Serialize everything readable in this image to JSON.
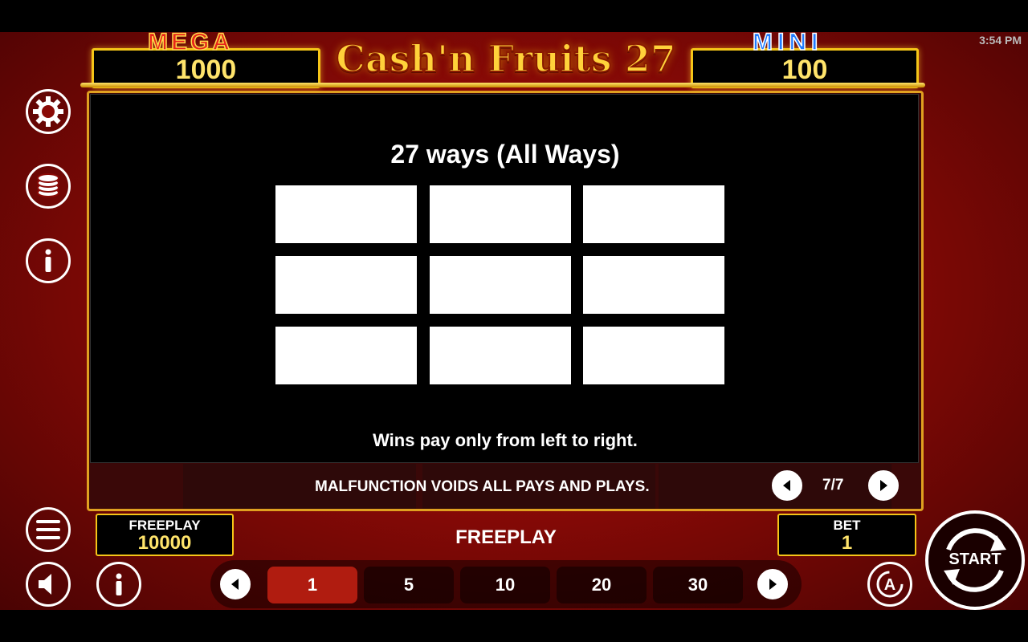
{
  "status": {
    "time": "3:54 PM"
  },
  "jackpots": {
    "mega": {
      "label": "MEGA",
      "value": "1000"
    },
    "mini": {
      "label": "MINI",
      "value": "100"
    }
  },
  "game": {
    "title": "Cash'n Fruits 27"
  },
  "paytable": {
    "title": "27 ways (All Ways)",
    "note": "Wins pay only from left to right.",
    "disclaimer": "MALFUNCTION VOIDS ALL PAYS AND PLAYS.",
    "page": "7/7"
  },
  "credits": {
    "label": "FREEPLAY",
    "value": "10000"
  },
  "mode_label": "FREEPLAY",
  "bet": {
    "label": "BET",
    "value": "1"
  },
  "bet_options": [
    "1",
    "5",
    "10",
    "20",
    "30"
  ],
  "selected_bet": "1",
  "start_label": "START",
  "icons": [
    "gear-icon",
    "coin-stack-icon",
    "info-icon",
    "menu-icon",
    "speaker-icon",
    "info-icon",
    "chevron-left-icon",
    "chevron-right-icon",
    "autoplay-icon",
    "refresh-arrows-icon"
  ],
  "colors": {
    "gold": "#f5c518",
    "jackpot_value": "#ffe46b",
    "selected_bet": "#b01c10",
    "background": "#8a0a06"
  }
}
